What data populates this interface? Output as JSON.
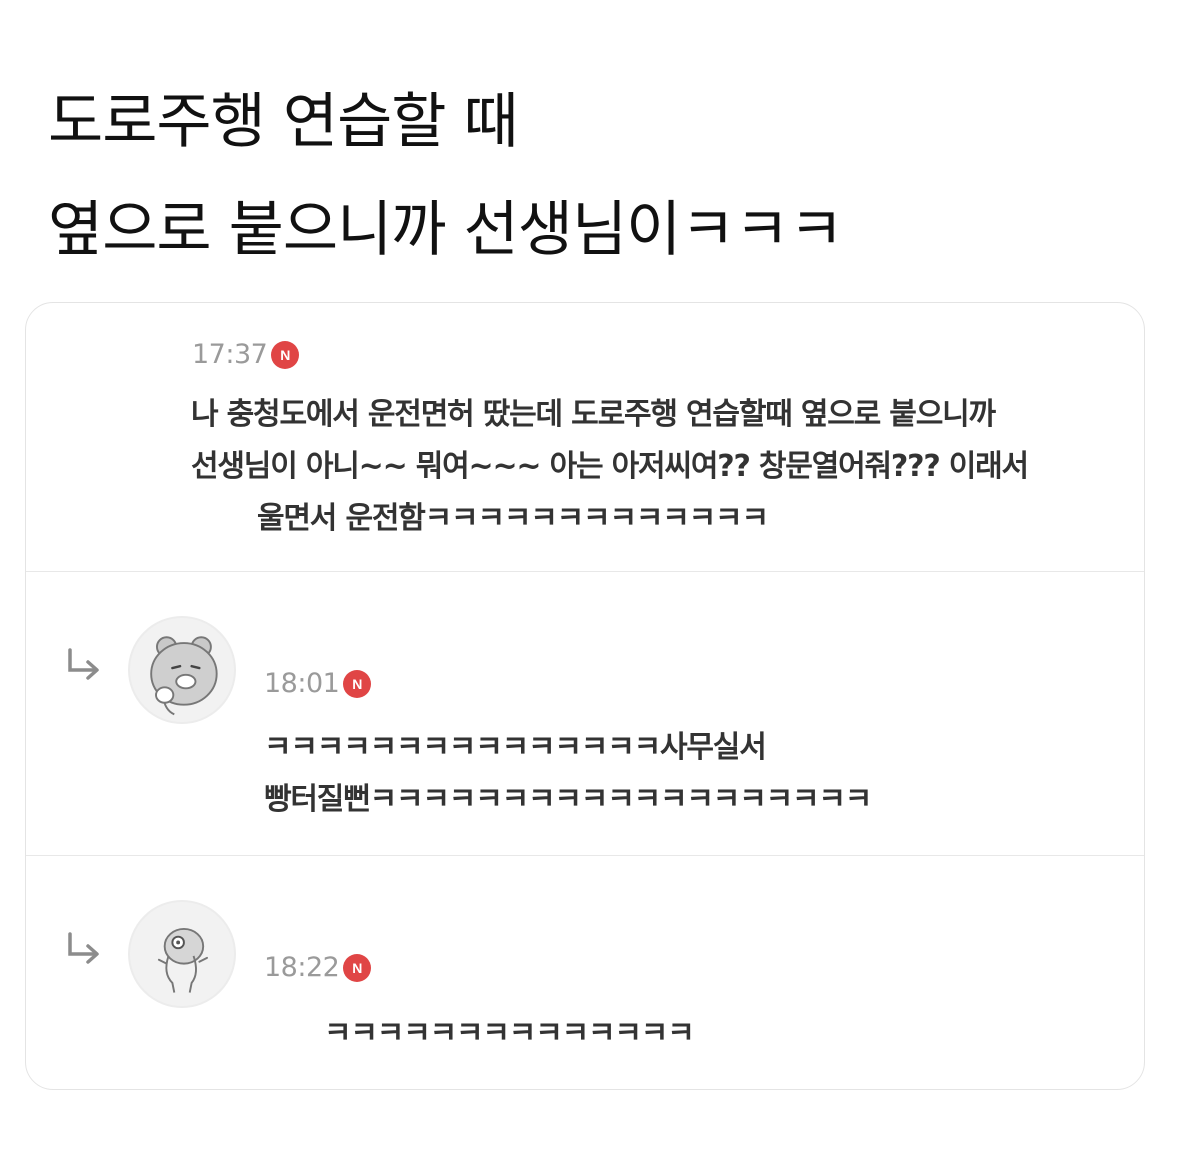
{
  "post": {
    "title_lines": [
      "도로주행 연습할 때",
      "옆으로 붙으니까 선생님이ㅋㅋㅋ"
    ]
  },
  "comments": [
    {
      "time": "17:37",
      "badge": "N",
      "lines": [
        "나 충청도에서 운전면허 땄는데 도로주행 연습할때 옆으로 붙으니까",
        "선생님이 아니~~ 뭐여~~~ 아는 아저씨여?? 창문열어줘??? 이래서",
        "울면서 운전함ㅋㅋㅋㅋㅋㅋㅋㅋㅋㅋㅋㅋㅋ"
      ]
    },
    {
      "time": "18:01",
      "badge": "N",
      "avatar_icon": "bear-avatar-icon",
      "reply_icon": "reply-arrow-icon",
      "lines": [
        "ㅋㅋㅋㅋㅋㅋㅋㅋㅋㅋㅋㅋㅋㅋㅋ사무실서",
        "빵터질뻔ㅋㅋㅋㅋㅋㅋㅋㅋㅋㅋㅋㅋㅋㅋㅋㅋㅋㅋㅋ"
      ]
    },
    {
      "time": "18:22",
      "badge": "N",
      "avatar_icon": "character-avatar-icon",
      "reply_icon": "reply-arrow-icon",
      "lines": [
        "ㅋㅋㅋㅋㅋㅋㅋㅋㅋㅋㅋㅋㅋㅋ"
      ]
    }
  ],
  "colors": {
    "badge": "#e04545",
    "time": "#9a9a9a",
    "text": "#333333",
    "divider": "#e8e8e8"
  }
}
